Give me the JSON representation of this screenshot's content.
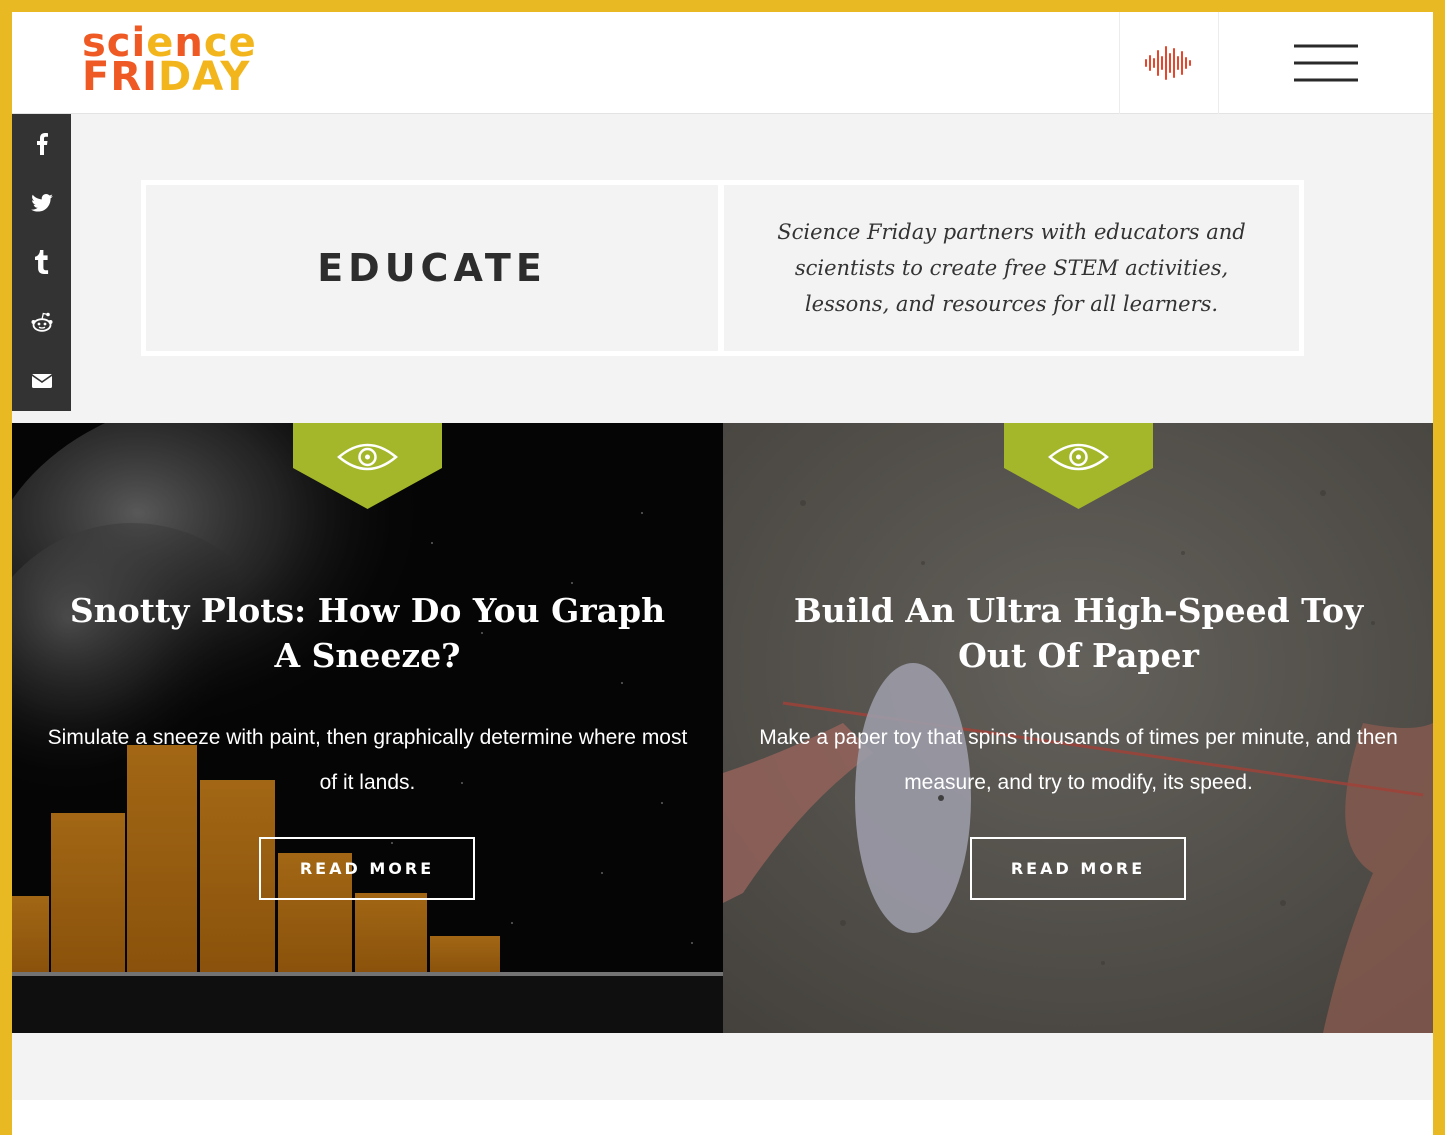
{
  "brand": {
    "logo_line1": "science",
    "logo_line2": "FRIDAY",
    "colors": {
      "orange": "#ef5a24",
      "yellow": "#f2b51b",
      "badge_green": "#a4b62a",
      "frame_yellow": "#e8b923"
    }
  },
  "header": {
    "audio_icon": "audio-waveform-icon",
    "menu_icon": "hamburger-menu-icon"
  },
  "social": {
    "items": [
      {
        "name": "facebook",
        "glyph": "f"
      },
      {
        "name": "twitter",
        "glyph": "🐦"
      },
      {
        "name": "tumblr",
        "glyph": "t"
      },
      {
        "name": "reddit",
        "glyph": "👽"
      },
      {
        "name": "email",
        "glyph": "✉"
      }
    ]
  },
  "intro": {
    "heading": "EDUCATE",
    "text": "Science Friday partners with educators and scientists to create free STEM activities, lessons, and resources for all learners."
  },
  "cards": [
    {
      "title": "Snotty Plots: How Do You Graph A Sneeze?",
      "description": "Simulate a sneeze with paint, then graphically determine where most of it lands.",
      "button": "READ MORE",
      "badge_icon": "eye-icon"
    },
    {
      "title": "Build An Ultra High-Speed Toy Out Of Paper",
      "description": "Make a paper toy that spins thousands of times per minute, and then measure, and try to modify, its speed.",
      "button": "READ MORE",
      "badge_icon": "eye-icon"
    }
  ]
}
